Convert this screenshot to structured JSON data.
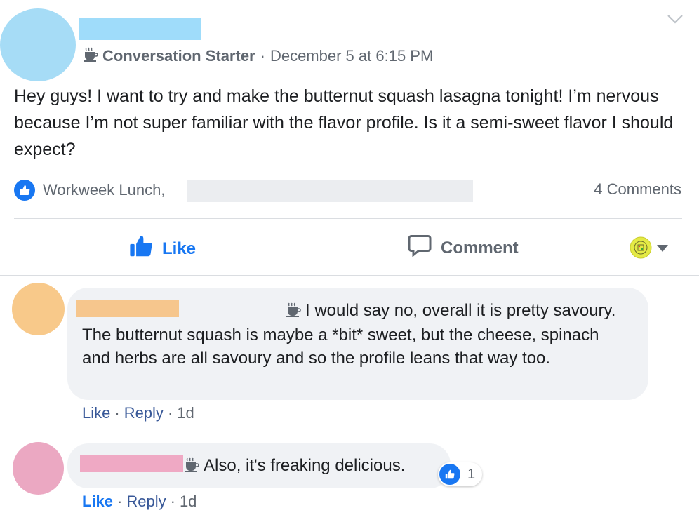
{
  "post": {
    "badge_icon": "coffee-cup-icon",
    "badge_name": "Conversation Starter",
    "separator": "·",
    "timestamp": "December 5 at 6:15 PM",
    "body": "Hey guys! I want to try and make the butternut squash lasagna tonight! I’m nervous because I’m not super familiar with the flavor profile. Is it a semi-sweet flavor I should expect?",
    "reactors": "Workweek Lunch,",
    "comments_count": "4 Comments"
  },
  "actions": {
    "like": "Like",
    "comment": "Comment"
  },
  "comments": [
    {
      "badge_icon": "coffee-cup-icon",
      "text": "I would say no, overall it is pretty savoury. The butternut squash is maybe a *bit* sweet, but the cheese, spinach and herbs are all savoury and so the profile leans that way too.",
      "like": "Like",
      "sep": "·",
      "reply": "Reply",
      "time": "1d"
    },
    {
      "badge_icon": "coffee-cup-icon",
      "text": "Also, it's freaking delicious.",
      "like": "Like",
      "sep": "·",
      "reply": "Reply",
      "time": "1d",
      "reaction_count": "1"
    }
  ],
  "colors": {
    "accent": "#1877f2",
    "link": "#385898",
    "poster_avatar": "#a6dcf6",
    "poster_name_redact": "#9fdcfa",
    "commenter1_avatar": "#f8c98a",
    "commenter1_redact": "#f6c68d",
    "commenter2_avatar": "#eba8c2",
    "commenter2_redact": "#efa9c4",
    "bubble_bg": "#f0f2f5"
  }
}
